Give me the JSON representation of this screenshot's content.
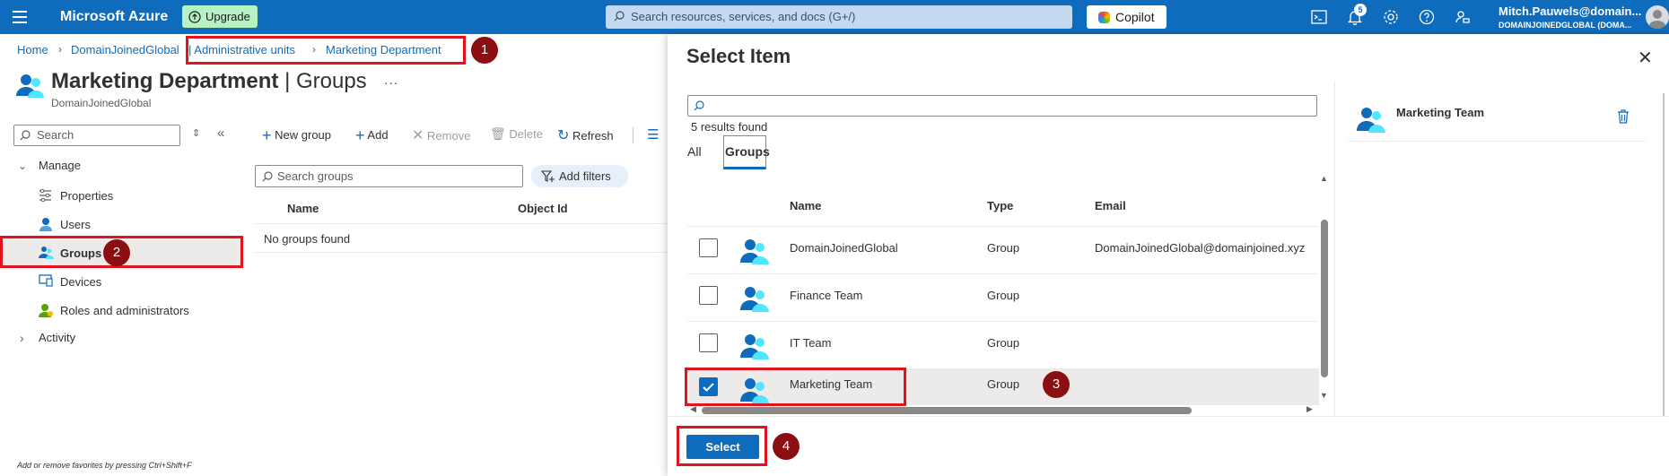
{
  "topbar": {
    "brand": "Microsoft Azure",
    "upgrade_label": "Upgrade",
    "search_placeholder": "Search resources, services, and docs (G+/)",
    "copilot_label": "Copilot",
    "notification_count": "5",
    "user_name": "Mitch.Pauwels@domain...",
    "user_directory": "DOMAINJOINEDGLOBAL (DOMA..."
  },
  "breadcrumb": {
    "items": [
      "Home",
      "DomainJoinedGlobal",
      "| Administrative units",
      "Marketing Department"
    ]
  },
  "page": {
    "title": "Marketing Department",
    "title_suffix": "| Groups",
    "subtitle": "DomainJoinedGlobal",
    "more": "..."
  },
  "sidebar": {
    "search_placeholder": "Search",
    "manage_label": "Manage",
    "items": [
      {
        "label": "Properties"
      },
      {
        "label": "Users"
      },
      {
        "label": "Groups"
      },
      {
        "label": "Devices"
      },
      {
        "label": "Roles and administrators"
      }
    ],
    "activity_label": "Activity",
    "favorites_hint": "Add or remove favorites by pressing Ctrl+Shift+F"
  },
  "toolbar": {
    "new_group": "New group",
    "add": "Add",
    "remove": "Remove",
    "delete": "Delete",
    "refresh": "Refresh"
  },
  "groups_list": {
    "search_placeholder": "Search groups",
    "add_filters": "Add filters",
    "columns": [
      "Name",
      "Object Id"
    ],
    "empty_text": "No groups found"
  },
  "select_panel": {
    "title": "Select Item",
    "results_count": "5 results found",
    "tabs": [
      "All",
      "Groups"
    ],
    "columns": [
      "Name",
      "Type",
      "Email"
    ],
    "rows": [
      {
        "name": "DomainJoinedGlobal",
        "type": "Group",
        "email": "DomainJoinedGlobal@domainjoined.xyz",
        "checked": false
      },
      {
        "name": "Finance Team",
        "type": "Group",
        "email": "",
        "checked": false
      },
      {
        "name": "IT Team",
        "type": "Group",
        "email": "",
        "checked": false
      },
      {
        "name": "Marketing Team",
        "type": "Group",
        "email": "",
        "checked": true
      }
    ],
    "selected_item": "Marketing Team",
    "select_button": "Select"
  },
  "annotations": [
    "1",
    "2",
    "3",
    "4"
  ],
  "colors": {
    "azure_blue": "#0f6cbd",
    "annotation_red": "#e0141e",
    "annotation_dot": "#8b0e12"
  }
}
